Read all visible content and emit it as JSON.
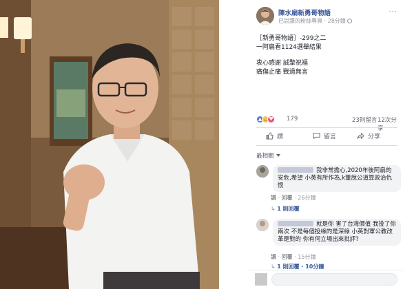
{
  "post": {
    "page_name": "陳水扁新勇哥物語",
    "meta": "已說讚的粉絲專頁 · 28分鐘",
    "more_label": "···",
    "lines": [
      "［新勇哥物語］-299之二",
      "一阿扁看1124選舉結果"
    ],
    "lines2": [
      "衷心感謝 誠摯祝福",
      "痛傷止痛 戰過無言"
    ]
  },
  "stats": {
    "reactions": "179",
    "comments": "23則留言",
    "shares": "12次分享"
  },
  "actions": {
    "like": "讚",
    "comment": "留言",
    "share": "分享"
  },
  "sort_label": "最相關",
  "comments": [
    {
      "text": "我非常擔心,2020年後阿扁的安危,希望 小英有所作為,k董說公道算政治仇恨",
      "like": "讚",
      "reply": "回覆",
      "time": "26分鐘",
      "replies": "1 則回覆"
    },
    {
      "text": "就是你 害了台灣價值 我投了你兩次 不是每個投綠的是深綠 小英對軍公教改革是對的 你有何立場出來批評?",
      "like": "讚",
      "reply": "回覆",
      "time": "15分鐘",
      "replies": "1 則回覆 · 10分鐘"
    }
  ],
  "colors": {
    "link": "#385898",
    "meta": "#90949c",
    "bubble": "#f2f3f5"
  },
  "icons": {
    "like": "thumbs-up-icon",
    "comment": "speech-bubble-icon",
    "share": "share-arrow-icon",
    "globe": "globe-icon"
  }
}
